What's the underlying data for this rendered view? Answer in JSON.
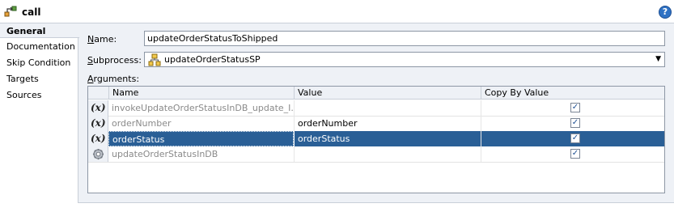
{
  "header": {
    "title": "call",
    "help_glyph": "?"
  },
  "sidebar": {
    "items": [
      {
        "label": "General",
        "active": true
      },
      {
        "label": "Documentation",
        "active": false
      },
      {
        "label": "Skip Condition",
        "active": false
      },
      {
        "label": "Targets",
        "active": false
      },
      {
        "label": "Sources",
        "active": false
      }
    ]
  },
  "form": {
    "name_label_key": "N",
    "name_label_rest": "ame:",
    "name_value": "updateOrderStatusToShipped",
    "subprocess_label_key": "S",
    "subprocess_label_rest": "ubprocess:",
    "subprocess_value": "updateOrderStatusSP",
    "arguments_label_key": "A",
    "arguments_label_rest": "rguments:"
  },
  "table": {
    "columns": [
      "Name",
      "Value",
      "Copy By Value"
    ],
    "rows": [
      {
        "icon": "variable-icon",
        "name": "invokeUpdateOrderStatusInDB_update_I...",
        "value": "",
        "copy": true,
        "selected": false
      },
      {
        "icon": "variable-icon",
        "name": "orderNumber",
        "value": "orderNumber",
        "copy": true,
        "selected": false
      },
      {
        "icon": "variable-icon",
        "name": "orderStatus",
        "value": "orderStatus",
        "copy": true,
        "selected": true
      },
      {
        "icon": "gear-icon",
        "name": "updateOrderStatusInDB",
        "value": "",
        "copy": true,
        "selected": false
      }
    ]
  },
  "colors": {
    "selection": "#2a5f96",
    "panel_bg": "#eef1f6",
    "help_blue": "#2f72c4"
  }
}
